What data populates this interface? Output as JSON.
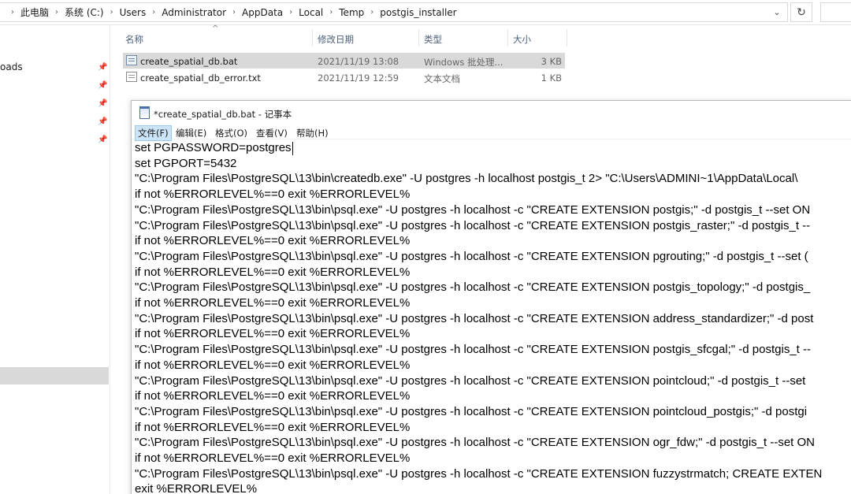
{
  "address_bar": {
    "crumbs": [
      "此电脑",
      "系统 (C:)",
      "Users",
      "Administrator",
      "AppData",
      "Local",
      "Temp",
      "postgis_installer"
    ]
  },
  "nav": {
    "downloads_label": "oads"
  },
  "file_list": {
    "columns": [
      "名称",
      "修改日期",
      "类型",
      "大小"
    ],
    "files": [
      {
        "name": "create_spatial_db.bat",
        "date": "2021/11/19 13:08",
        "type": "Windows 批处理...",
        "size": "3 KB"
      },
      {
        "name": "create_spatial_db_error.txt",
        "date": "2021/11/19 12:59",
        "type": "文本文档",
        "size": "1 KB"
      }
    ]
  },
  "notepad": {
    "title": "*create_spatial_db.bat - 记事本",
    "menus": [
      "文件(F)",
      "编辑(E)",
      "格式(O)",
      "查看(V)",
      "帮助(H)"
    ],
    "lines": [
      "set PGPASSWORD=postgres",
      "set PGPORT=5432",
      "\"C:\\Program Files\\PostgreSQL\\13\\bin\\createdb.exe\" -U postgres -h localhost postgis_t 2> \"C:\\Users\\ADMINI~1\\AppData\\Local\\",
      "if not %ERRORLEVEL%==0 exit %ERRORLEVEL%",
      "\"C:\\Program Files\\PostgreSQL\\13\\bin\\psql.exe\" -U postgres -h localhost -c \"CREATE EXTENSION postgis;\" -d postgis_t --set ON",
      "\"C:\\Program Files\\PostgreSQL\\13\\bin\\psql.exe\" -U postgres -h localhost -c \"CREATE EXTENSION postgis_raster;\" -d postgis_t --",
      "if not %ERRORLEVEL%==0 exit %ERRORLEVEL%",
      "\"C:\\Program Files\\PostgreSQL\\13\\bin\\psql.exe\" -U postgres -h localhost -c \"CREATE EXTENSION pgrouting;\" -d postgis_t --set (",
      "if not %ERRORLEVEL%==0 exit %ERRORLEVEL%",
      "\"C:\\Program Files\\PostgreSQL\\13\\bin\\psql.exe\" -U postgres -h localhost -c \"CREATE EXTENSION postgis_topology;\" -d postgis_",
      "if not %ERRORLEVEL%==0 exit %ERRORLEVEL%",
      "\"C:\\Program Files\\PostgreSQL\\13\\bin\\psql.exe\" -U postgres -h localhost -c \"CREATE EXTENSION address_standardizer;\" -d post",
      "if not %ERRORLEVEL%==0 exit %ERRORLEVEL%",
      "\"C:\\Program Files\\PostgreSQL\\13\\bin\\psql.exe\" -U postgres -h localhost -c \"CREATE EXTENSION postgis_sfcgal;\" -d postgis_t --",
      "if not %ERRORLEVEL%==0 exit %ERRORLEVEL%",
      "\"C:\\Program Files\\PostgreSQL\\13\\bin\\psql.exe\" -U postgres -h localhost -c \"CREATE EXTENSION pointcloud;\" -d postgis_t --set",
      "if not %ERRORLEVEL%==0 exit %ERRORLEVEL%",
      "\"C:\\Program Files\\PostgreSQL\\13\\bin\\psql.exe\" -U postgres -h localhost -c \"CREATE EXTENSION pointcloud_postgis;\" -d postgi",
      "if not %ERRORLEVEL%==0 exit %ERRORLEVEL%",
      "\"C:\\Program Files\\PostgreSQL\\13\\bin\\psql.exe\" -U postgres -h localhost -c \"CREATE EXTENSION ogr_fdw;\" -d postgis_t --set ON",
      "if not %ERRORLEVEL%==0 exit %ERRORLEVEL%",
      "\"C:\\Program Files\\PostgreSQL\\13\\bin\\psql.exe\" -U postgres -h localhost -c \"CREATE EXTENSION fuzzystrmatch; CREATE EXTEN",
      "exit %ERRORLEVEL%"
    ]
  }
}
